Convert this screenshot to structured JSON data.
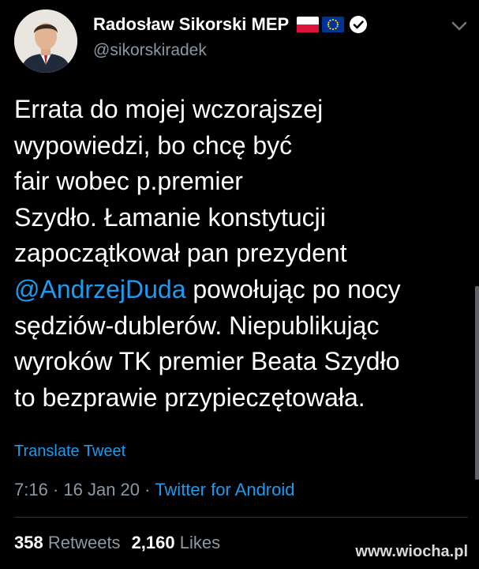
{
  "author": {
    "display_name": "Radosław Sikorski MEP",
    "handle": "@sikorskiradek",
    "avatar_icon": "profile-photo",
    "flags": [
      "poland-flag-icon",
      "eu-flag-icon"
    ],
    "verified_icon": "verified-badge-icon"
  },
  "tweet": {
    "lines": [
      "Errata do mojej wczorajszej",
      "wypowiedzi, bo chcę być",
      "fair wobec p.premier",
      "Szydło. Łamanie konstytucji",
      "zapoczątkował pan prezydent",
      "powołując po nocy",
      "sędziów-dublerów. Niepublikując",
      "wyroków TK premier Beata Szydło",
      "to bezprawie przypieczętowała."
    ],
    "mention": "@AndrzejDuda"
  },
  "translate_label": "Translate Tweet",
  "meta": {
    "time": "7:16",
    "sep1": " · ",
    "date": "16 Jan 20",
    "sep2": " · ",
    "source": "Twitter for Android"
  },
  "stats": {
    "retweets_count": "358",
    "retweets_label": "Retweets",
    "likes_count": "2,160",
    "likes_label": "Likes"
  },
  "watermark": "www.wiocha.pl",
  "colors": {
    "background": "#000000",
    "accent": "#1d9bf0",
    "secondary_text": "#8b98a5",
    "divider": "#2f3336"
  }
}
